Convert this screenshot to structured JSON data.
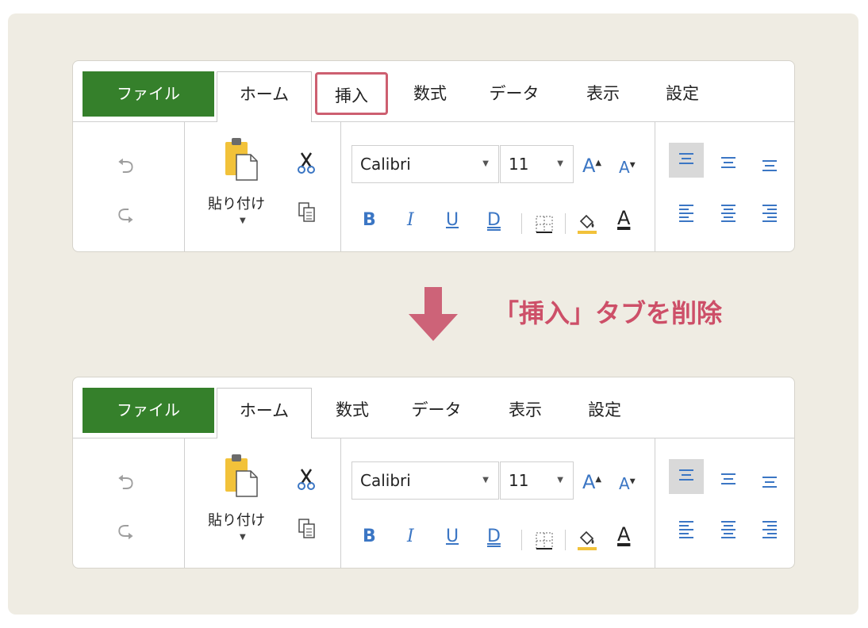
{
  "before": {
    "tabs": [
      {
        "label": "ファイル"
      },
      {
        "label": "ホーム"
      },
      {
        "label": "挿入"
      },
      {
        "label": "数式"
      },
      {
        "label": "データ"
      },
      {
        "label": "表示"
      },
      {
        "label": "設定"
      }
    ],
    "highlighted_tab": "挿入"
  },
  "after": {
    "tabs": [
      {
        "label": "ファイル"
      },
      {
        "label": "ホーム"
      },
      {
        "label": "数式"
      },
      {
        "label": "データ"
      },
      {
        "label": "表示"
      },
      {
        "label": "設定"
      }
    ]
  },
  "ribbon": {
    "paste_label": "貼り付け",
    "font_name": "Calibri",
    "font_size": "11",
    "bold_label": "B",
    "italic_label": "I",
    "underline_label": "U",
    "double_underline_label": "D",
    "font_color_label": "A",
    "grow_label": "A",
    "shrink_label": "A"
  },
  "caption": "「挿入」タブを削除",
  "colors": {
    "file_tab": "#35802b",
    "highlight": "#cd5f70",
    "accent_blue": "#3b76c4",
    "arrow": "#cd6378",
    "caption": "#cd4f68",
    "panel": "#efece3"
  }
}
